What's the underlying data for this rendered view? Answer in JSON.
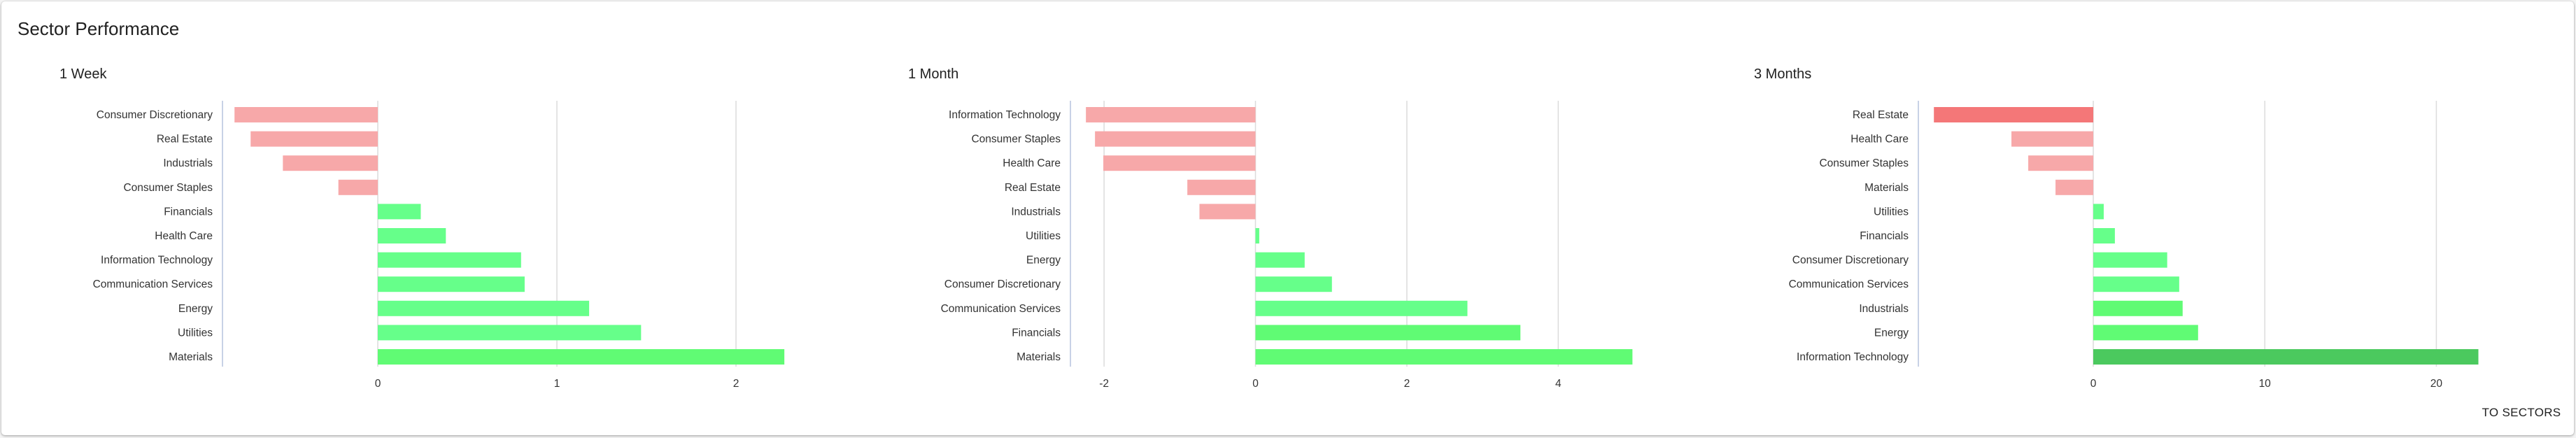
{
  "title": "Sector Performance",
  "to_sectors_label": "TO SECTORS",
  "colors": {
    "neg_light": "#f7a8a9",
    "neg_strong": "#f47778",
    "pos_light": "#66ff8a",
    "pos_medium": "#60fb74",
    "pos_strong": "#4bc95e",
    "axis_line": "#c8d2e6",
    "grid_line": "#dcdcdc"
  },
  "chart_data": [
    {
      "type": "bar",
      "orientation": "horizontal",
      "title": "1 Week",
      "xlabel": "",
      "ylabel": "",
      "xlim": [
        -0.97,
        2.45
      ],
      "xticks": [
        0,
        1,
        2
      ],
      "grid": true,
      "categories": [
        "Consumer Discretionary",
        "Real Estate",
        "Industrials",
        "Consumer Staples",
        "Financials",
        "Health Care",
        "Information Technology",
        "Communication Services",
        "Energy",
        "Utilities",
        "Materials"
      ],
      "values": [
        -0.8,
        -0.71,
        -0.53,
        -0.22,
        0.24,
        0.38,
        0.8,
        0.82,
        1.18,
        1.47,
        2.27
      ],
      "bar_colors": [
        "neg_light",
        "neg_light",
        "neg_light",
        "neg_light",
        "pos_light",
        "pos_light",
        "pos_light",
        "pos_light",
        "pos_light",
        "pos_light",
        "pos_medium"
      ]
    },
    {
      "type": "bar",
      "orientation": "horizontal",
      "title": "1 Month",
      "xlabel": "",
      "ylabel": "",
      "xlim": [
        -2.44,
        5.35
      ],
      "xticks": [
        -2,
        0,
        2,
        4
      ],
      "grid": true,
      "categories": [
        "Information Technology",
        "Consumer Staples",
        "Health Care",
        "Real Estate",
        "Industrials",
        "Utilities",
        "Energy",
        "Consumer Discretionary",
        "Communication Services",
        "Financials",
        "Materials"
      ],
      "values": [
        -2.24,
        -2.12,
        -2.01,
        -0.9,
        -0.74,
        0.05,
        0.65,
        1.01,
        2.8,
        3.5,
        4.98
      ],
      "bar_colors": [
        "neg_light",
        "neg_light",
        "neg_light",
        "neg_light",
        "neg_light",
        "pos_light",
        "pos_light",
        "pos_light",
        "pos_light",
        "pos_medium",
        "pos_medium"
      ]
    },
    {
      "type": "bar",
      "orientation": "horizontal",
      "title": "3 Months",
      "xlabel": "",
      "ylabel": "",
      "xlim": [
        -10.2,
        23.8
      ],
      "xticks": [
        0,
        10,
        20
      ],
      "grid": true,
      "categories": [
        "Real Estate",
        "Health Care",
        "Consumer Staples",
        "Materials",
        "Utilities",
        "Financials",
        "Consumer Discretionary",
        "Communication Services",
        "Industrials",
        "Energy",
        "Information Technology"
      ],
      "values": [
        -9.29,
        -4.77,
        -3.79,
        -2.2,
        0.61,
        1.26,
        4.31,
        5.01,
        5.21,
        6.11,
        22.45
      ],
      "bar_colors": [
        "neg_strong",
        "neg_light",
        "neg_light",
        "neg_light",
        "pos_light",
        "pos_light",
        "pos_light",
        "pos_light",
        "pos_medium",
        "pos_medium",
        "pos_strong"
      ]
    }
  ]
}
